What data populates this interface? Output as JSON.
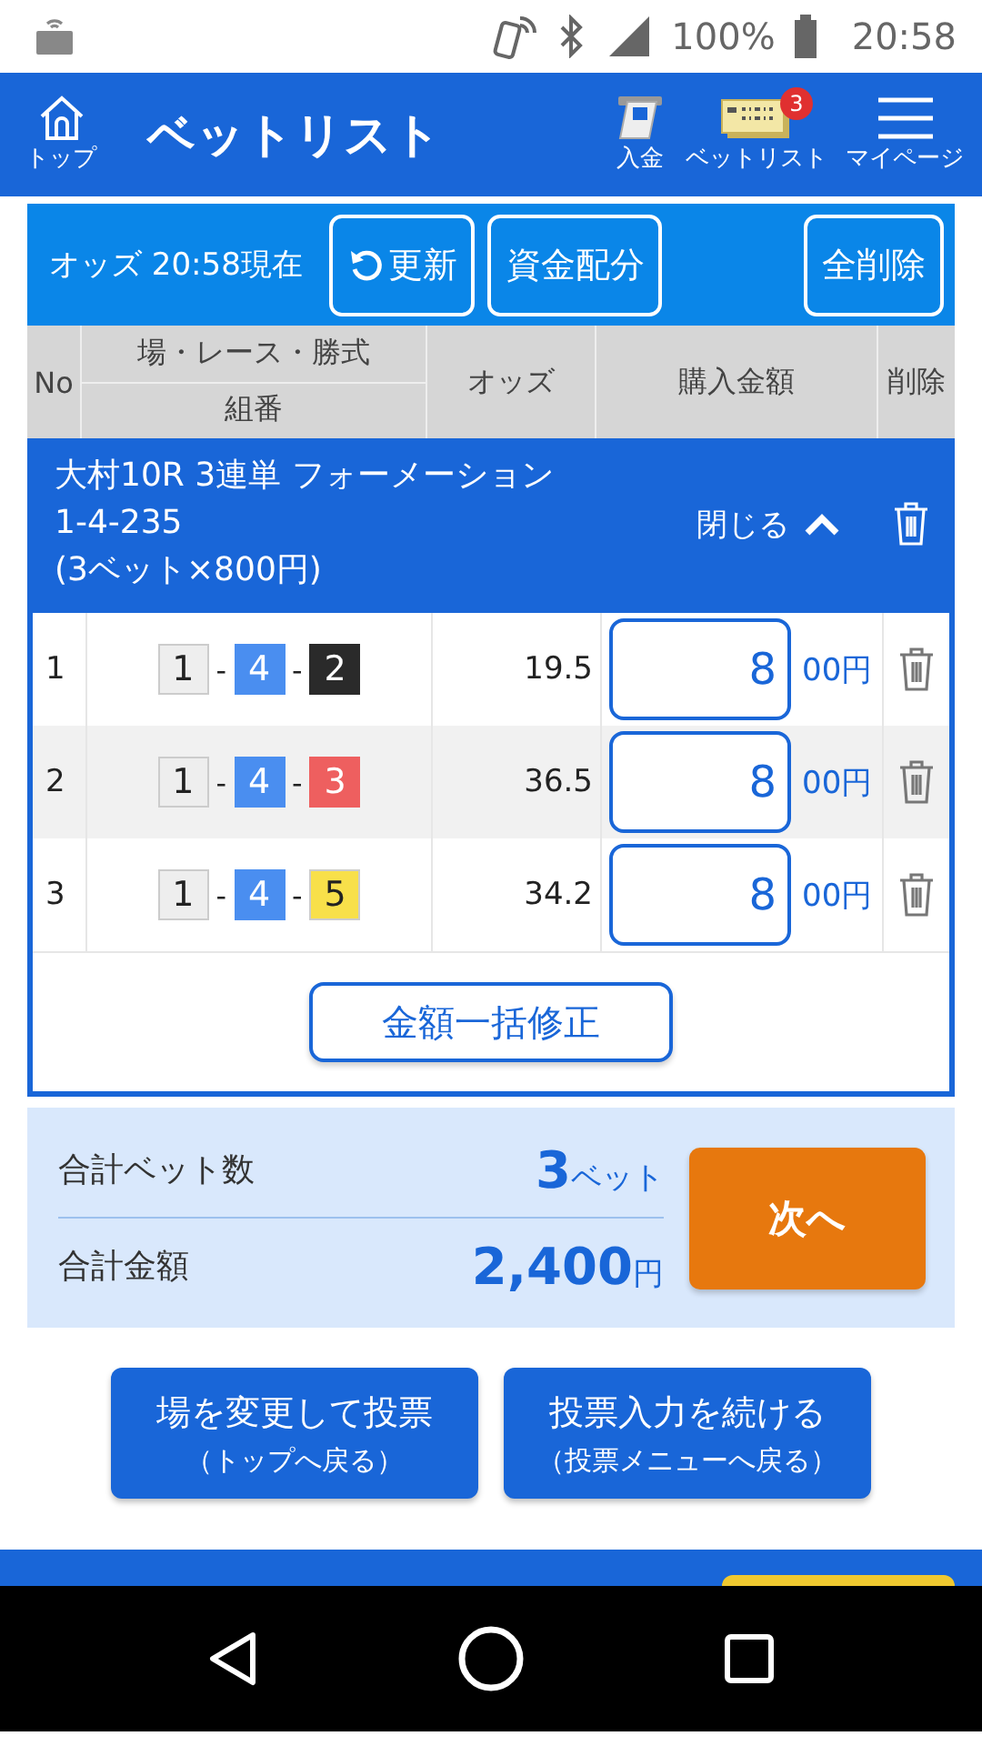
{
  "status_bar": {
    "battery": "100%",
    "time": "20:58"
  },
  "header": {
    "home_label": "トップ",
    "title": "ベットリスト",
    "actions": [
      {
        "kind": "deposit",
        "label": "入金"
      },
      {
        "kind": "betlist",
        "label": "ベットリスト",
        "badge": "3"
      },
      {
        "kind": "menu",
        "label": "マイページ"
      }
    ]
  },
  "toolbar": {
    "odds_time": "オッズ 20:58現在",
    "refresh": "更新",
    "allocate": "資金配分",
    "delete_all": "全削除"
  },
  "table": {
    "columns": {
      "no": "No",
      "race": "場・レース・勝式",
      "combo": "組番",
      "odds": "オッズ",
      "amount": "購入金額",
      "delete": "削除"
    },
    "group": {
      "title": "大村10R 3連単 フォーメーション",
      "combo": "1-4-235",
      "summary": "(3ベット×800円)",
      "collapse": "閉じる"
    },
    "rows": [
      {
        "no": "1",
        "boats": [
          {
            "number": "1",
            "color": "#eeeeee"
          },
          {
            "number": "4",
            "color": "#4a8ef0"
          },
          {
            "number": "2",
            "color": "#2a2a2a"
          }
        ],
        "separator": "-",
        "odds": "19.5",
        "amount": "8",
        "unit": "00円"
      },
      {
        "no": "2",
        "boats": [
          {
            "number": "1",
            "color": "#eeeeee"
          },
          {
            "number": "4",
            "color": "#4a8ef0"
          },
          {
            "number": "3",
            "color": "#ee5f5f"
          }
        ],
        "separator": "-",
        "odds": "36.5",
        "amount": "8",
        "unit": "00円"
      },
      {
        "no": "3",
        "boats": [
          {
            "number": "1",
            "color": "#eeeeee"
          },
          {
            "number": "4",
            "color": "#4a8ef0"
          },
          {
            "number": "5",
            "color": "#f8e04a"
          }
        ],
        "separator": "-",
        "odds": "34.2",
        "amount": "8",
        "unit": "00円"
      }
    ],
    "bulk_edit": "金額一括修正"
  },
  "summary": {
    "bet_count_label": "合計ベット数",
    "bet_count": "3",
    "bet_unit": "ベット",
    "total_label": "合計金額",
    "total": "2,400",
    "total_unit": "円",
    "next": "次へ"
  },
  "buttons": [
    {
      "label": "場を変更して投票",
      "sub": "（トップへ戻る）"
    },
    {
      "label": "投票入力を続ける",
      "sub": "（投票メニューへ戻る）"
    }
  ]
}
